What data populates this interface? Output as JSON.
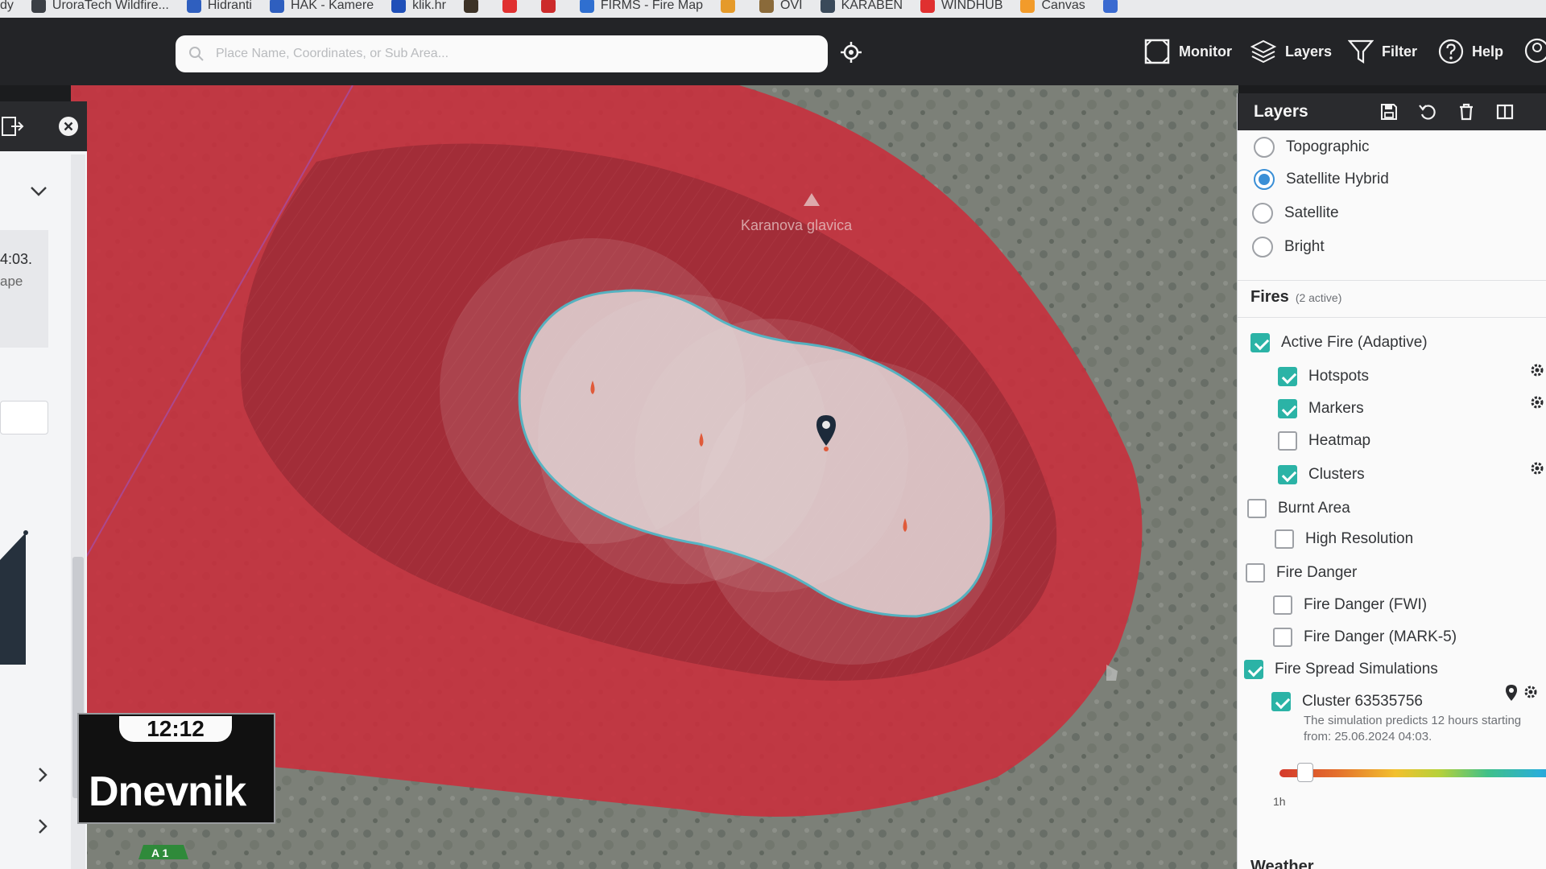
{
  "bookmarks": [
    {
      "label": "dy",
      "color": "#00000000"
    },
    {
      "label": "UroraTech Wildfire...",
      "color": "#3b3f45"
    },
    {
      "label": "Hidranti",
      "color": "#2f5fbf"
    },
    {
      "label": "HAK - Kamere",
      "color": "#2f5fbf"
    },
    {
      "label": "klik.hr",
      "color": "#1f4fb8"
    },
    {
      "label": "",
      "color": "#3c3226"
    },
    {
      "label": "",
      "color": "#e03030"
    },
    {
      "label": "",
      "color": "#cc2b2b"
    },
    {
      "label": "FIRMS - Fire Map",
      "color": "#2f6fd0"
    },
    {
      "label": "",
      "color": "#e59a2a"
    },
    {
      "label": "OVI",
      "color": "#8a6a3a"
    },
    {
      "label": "KARABEN",
      "color": "#3a4a5a"
    },
    {
      "label": "WINDHUB",
      "color": "#e03030"
    },
    {
      "label": "Canvas",
      "color": "#f29b2a"
    },
    {
      "label": "",
      "color": "#3a6ad0"
    }
  ],
  "toolbar": {
    "search_placeholder": "Place Name, Coordinates, or Sub Area...",
    "monitor_label": "Monitor",
    "layers_label": "Layers",
    "filter_label": "Filter",
    "help_label": "Help"
  },
  "map": {
    "place_label": "Karanova glavica",
    "road_shield": "A 1",
    "colors": {
      "burn_outer": "#c8303d",
      "burn_inner": "#9e2c37",
      "sim_outline": "#3fd0e0",
      "sim_fill": "#e3e0e0"
    }
  },
  "left_panel": {
    "text_time": "4:03.",
    "text_sub": "ape"
  },
  "layers_panel": {
    "title": "Layers",
    "basemaps": [
      {
        "label": "Topographic",
        "selected": false
      },
      {
        "label": "Satellite Hybrid",
        "selected": true
      },
      {
        "label": "Satellite",
        "selected": false
      },
      {
        "label": "Bright",
        "selected": false
      }
    ],
    "fires_title": "Fires",
    "fires_count": "(2 active)",
    "items": {
      "active_fire": "Active Fire (Adaptive)",
      "hotspots": "Hotspots",
      "markers": "Markers",
      "heatmap": "Heatmap",
      "clusters": "Clusters",
      "burnt_area": "Burnt Area",
      "high_resolution": "High Resolution",
      "fire_danger": "Fire Danger",
      "fire_danger_fwi": "Fire Danger (FWI)",
      "fire_danger_mark5": "Fire Danger (MARK-5)",
      "fire_spread": "Fire Spread Simulations",
      "cluster": "Cluster 63535756"
    },
    "checked": {
      "active_fire": true,
      "hotspots": true,
      "markers": true,
      "heatmap": false,
      "clusters": true,
      "burnt_area": false,
      "high_resolution": false,
      "fire_danger": false,
      "fire_danger_fwi": false,
      "fire_danger_mark5": false,
      "fire_spread": true,
      "cluster": true
    },
    "simulation_note": "The simulation predicts 12 hours starting from: 25.06.2024 04:03.",
    "slider_label": "1h",
    "slider_value_hours": 1,
    "weather_title": "Weather"
  },
  "overlay": {
    "time": "12:12",
    "channel": "Dnevnik"
  }
}
